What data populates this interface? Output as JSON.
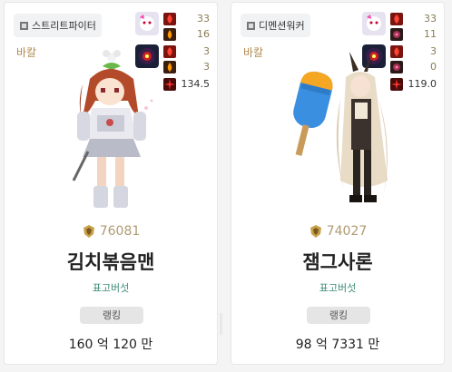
{
  "cards": [
    {
      "job": "스트리트파이터",
      "server": "바칼",
      "stats": [
        {
          "value": "33",
          "icon": "red-fire-icon"
        },
        {
          "value": "16",
          "icon": "orange-flame-icon"
        },
        {
          "value": "3",
          "icon": "red-fire-icon"
        },
        {
          "value": "3",
          "icon": "orange-flame-icon"
        },
        {
          "value": "134.5",
          "icon": "damage-cross-icon"
        }
      ],
      "fame": "76081",
      "name": "김치볶음맨",
      "guild": "표고버섯",
      "rank_label": "랭킹",
      "power": "160 억 120 만"
    },
    {
      "job": "디멘션워커",
      "server": "바칼",
      "stats": [
        {
          "value": "33",
          "icon": "red-fire-icon"
        },
        {
          "value": "11",
          "icon": "dark-rose-icon"
        },
        {
          "value": "3",
          "icon": "red-fire-icon"
        },
        {
          "value": "0",
          "icon": "dark-rose-icon"
        },
        {
          "value": "119.0",
          "icon": "damage-cross-icon"
        }
      ],
      "fame": "74027",
      "name": "잼그사론",
      "guild": "표고버섯",
      "rank_label": "랭킹",
      "power": "98 억 7331 만"
    }
  ],
  "colors": {
    "server": "#b08a4f",
    "guild": "#3c8a76",
    "fame": "#b09a72"
  }
}
